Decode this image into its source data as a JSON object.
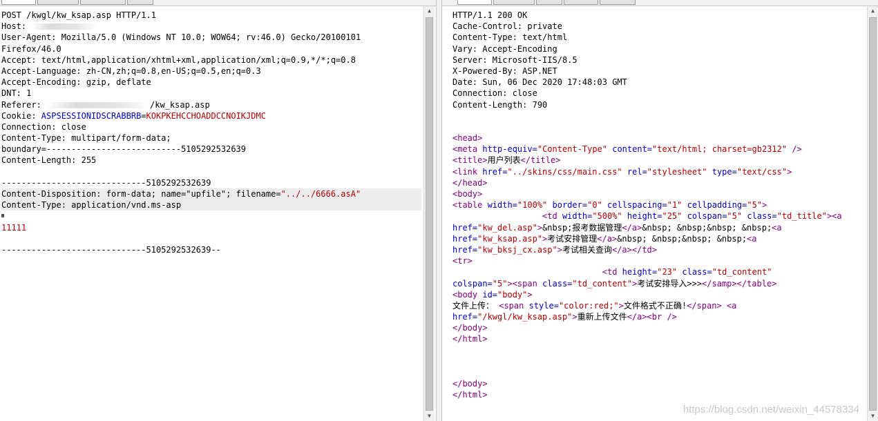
{
  "request": {
    "lines": [
      {
        "t": "POST /kwgl/kw_ksap.asp HTTP/1.1"
      },
      {
        "t": "Host: ",
        "blur": true
      },
      {
        "t": "User-Agent: Mozilla/5.0 (Windows NT 10.0; WOW64; rv:46.0) Gecko/20100101"
      },
      {
        "t": "Firefox/46.0"
      },
      {
        "t": "Accept: text/html,application/xhtml+xml,application/xml;q=0.9,*/*;q=0.8"
      },
      {
        "t": "Accept-Language: zh-CN,zh;q=0.8,en-US;q=0.5,en;q=0.3"
      },
      {
        "t": "Accept-Encoding: gzip, deflate"
      },
      {
        "t": "DNT: 1"
      },
      {
        "t": "Referer: ",
        "blur2": true,
        "t2": "/kw_ksap.asp"
      },
      {
        "cookie": true
      },
      {
        "t": "Connection: close"
      },
      {
        "t": "Content-Type: multipart/form-data;"
      },
      {
        "t": "boundary=---------------------------5105292532639"
      },
      {
        "t": "Content-Length: 255"
      },
      {
        "t": ""
      },
      {
        "t": "-----------------------------5105292532639"
      },
      {
        "disp": true,
        "hl": true
      },
      {
        "t": "Content-Type: application/vnd.ms-asp",
        "hl": true
      },
      {
        "t": "",
        "cursor": true
      },
      {
        "t": "11111",
        "red": true
      },
      {
        "t": ""
      },
      {
        "t": "-----------------------------5105292532639--"
      }
    ],
    "cookie_label": "Cookie: ",
    "cookie_name": "ASPSESSIONIDSCRABBRB",
    "cookie_value": "KOKPKEHCCHOADDCCNOIKJDMC",
    "disp_prefix": "Content-Disposition: form-data; name=\"upfile\"; filename=",
    "disp_filename": "\"../../6666.asA\""
  },
  "response": {
    "lines": [
      [
        {
          "c": "p",
          "t": "HTTP/1.1 200 OK"
        }
      ],
      [
        {
          "c": "p",
          "t": "Cache-Control: private"
        }
      ],
      [
        {
          "c": "p",
          "t": "Content-Type: text/html"
        }
      ],
      [
        {
          "c": "p",
          "t": "Vary: Accept-Encoding"
        }
      ],
      [
        {
          "c": "p",
          "t": "Server: Microsoft-IIS/8.5"
        }
      ],
      [
        {
          "c": "p",
          "t": "X-Powered-By: ASP.NET"
        }
      ],
      [
        {
          "c": "p",
          "t": "Date: Sun, 06 Dec 2020 17:48:03 GMT"
        }
      ],
      [
        {
          "c": "p",
          "t": "Connection: close"
        }
      ],
      [
        {
          "c": "p",
          "t": "Content-Length: 790"
        }
      ],
      [],
      [],
      [
        {
          "c": "tag",
          "t": "<head>"
        }
      ],
      [
        {
          "c": "tag",
          "t": "<meta "
        },
        {
          "c": "attr",
          "t": "http-equiv="
        },
        {
          "c": "val",
          "t": "\"Content-Type\""
        },
        {
          "c": "p",
          "t": " "
        },
        {
          "c": "attr",
          "t": "content="
        },
        {
          "c": "val",
          "t": "\"text/html; charset=gb2312\""
        },
        {
          "c": "tag",
          "t": " />"
        }
      ],
      [
        {
          "c": "tag",
          "t": "<title>"
        },
        {
          "c": "p",
          "t": "用户列表"
        },
        {
          "c": "tag",
          "t": "</title>"
        }
      ],
      [
        {
          "c": "tag",
          "t": "<link "
        },
        {
          "c": "attr",
          "t": "href="
        },
        {
          "c": "val",
          "t": "\"../skins/css/main.css\""
        },
        {
          "c": "p",
          "t": " "
        },
        {
          "c": "attr",
          "t": "rel="
        },
        {
          "c": "val",
          "t": "\"stylesheet\""
        },
        {
          "c": "p",
          "t": " "
        },
        {
          "c": "attr",
          "t": "type="
        },
        {
          "c": "val",
          "t": "\"text/css\""
        },
        {
          "c": "tag",
          "t": ">"
        }
      ],
      [
        {
          "c": "tag",
          "t": "</head>"
        }
      ],
      [
        {
          "c": "tag",
          "t": "<body>"
        }
      ],
      [
        {
          "c": "tag",
          "t": "<table "
        },
        {
          "c": "attr",
          "t": "width="
        },
        {
          "c": "val",
          "t": "\"100%\""
        },
        {
          "c": "p",
          "t": " "
        },
        {
          "c": "attr",
          "t": "border="
        },
        {
          "c": "val",
          "t": "\"0\""
        },
        {
          "c": "p",
          "t": " "
        },
        {
          "c": "attr",
          "t": "cellspacing="
        },
        {
          "c": "val",
          "t": "\"1\""
        },
        {
          "c": "p",
          "t": " "
        },
        {
          "c": "attr",
          "t": "cellpadding="
        },
        {
          "c": "val",
          "t": "\"5\""
        },
        {
          "c": "tag",
          "t": ">"
        }
      ],
      [
        {
          "c": "p",
          "t": "                  "
        },
        {
          "c": "tag",
          "t": "<td "
        },
        {
          "c": "attr",
          "t": "width="
        },
        {
          "c": "val",
          "t": "\"500%\""
        },
        {
          "c": "p",
          "t": " "
        },
        {
          "c": "attr",
          "t": "height="
        },
        {
          "c": "val",
          "t": "\"25\""
        },
        {
          "c": "p",
          "t": " "
        },
        {
          "c": "attr",
          "t": "colspan="
        },
        {
          "c": "val",
          "t": "\"5\""
        },
        {
          "c": "p",
          "t": " "
        },
        {
          "c": "attr",
          "t": "class="
        },
        {
          "c": "val",
          "t": "\"td_title\""
        },
        {
          "c": "tag",
          "t": "><a"
        }
      ],
      [
        {
          "c": "attr",
          "t": "href="
        },
        {
          "c": "val",
          "t": "\"kw_del.asp\""
        },
        {
          "c": "tag",
          "t": ">"
        },
        {
          "c": "p",
          "t": "&nbsp;报考数据管理"
        },
        {
          "c": "tag",
          "t": "</a>"
        },
        {
          "c": "p",
          "t": "&nbsp; &nbsp;&nbsp; &nbsp;"
        },
        {
          "c": "tag",
          "t": "<a"
        }
      ],
      [
        {
          "c": "attr",
          "t": "href="
        },
        {
          "c": "val",
          "t": "\"kw_ksap.asp\""
        },
        {
          "c": "tag",
          "t": ">"
        },
        {
          "c": "p",
          "t": "考试安排管理"
        },
        {
          "c": "tag",
          "t": "</a>"
        },
        {
          "c": "p",
          "t": "&nbsp; &nbsp;&nbsp; &nbsp;"
        },
        {
          "c": "tag",
          "t": "<a"
        }
      ],
      [
        {
          "c": "attr",
          "t": "href="
        },
        {
          "c": "val",
          "t": "\"kw_bksj_cx.asp\""
        },
        {
          "c": "tag",
          "t": ">"
        },
        {
          "c": "p",
          "t": "考试相关查询"
        },
        {
          "c": "tag",
          "t": "</a></td>"
        }
      ],
      [
        {
          "c": "tag",
          "t": "<tr>"
        }
      ],
      [
        {
          "c": "p",
          "t": "                              "
        },
        {
          "c": "tag",
          "t": "<td "
        },
        {
          "c": "attr",
          "t": "height="
        },
        {
          "c": "val",
          "t": "\"23\""
        },
        {
          "c": "p",
          "t": " "
        },
        {
          "c": "attr",
          "t": "class="
        },
        {
          "c": "val",
          "t": "\"td_content\""
        }
      ],
      [
        {
          "c": "attr",
          "t": "colspan="
        },
        {
          "c": "val",
          "t": "\"5\""
        },
        {
          "c": "tag",
          "t": "><span "
        },
        {
          "c": "attr",
          "t": "class="
        },
        {
          "c": "val",
          "t": "\"td_content\""
        },
        {
          "c": "tag",
          "t": ">"
        },
        {
          "c": "p",
          "t": "考试安排导入>>>"
        },
        {
          "c": "tag",
          "t": "</samp></table>"
        }
      ],
      [
        {
          "c": "tag",
          "t": "<body "
        },
        {
          "c": "attr",
          "t": "id="
        },
        {
          "c": "val",
          "t": "\"body\""
        },
        {
          "c": "tag",
          "t": ">"
        }
      ],
      [
        {
          "c": "p",
          "t": "文件上传： "
        },
        {
          "c": "tag",
          "t": "<span "
        },
        {
          "c": "attr",
          "t": "style="
        },
        {
          "c": "val",
          "t": "\"color:red;\""
        },
        {
          "c": "tag",
          "t": ">"
        },
        {
          "c": "p",
          "t": "文件格式不正确!"
        },
        {
          "c": "tag",
          "t": "</span>"
        },
        {
          "c": "p",
          "t": " "
        },
        {
          "c": "tag",
          "t": "<a"
        }
      ],
      [
        {
          "c": "attr",
          "t": "href="
        },
        {
          "c": "val",
          "t": "\"/kwgl/kw_ksap.asp\""
        },
        {
          "c": "tag",
          "t": ">"
        },
        {
          "c": "p",
          "t": "重新上传文件"
        },
        {
          "c": "tag",
          "t": "</a><br />"
        }
      ],
      [
        {
          "c": "tag",
          "t": "</body>"
        }
      ],
      [
        {
          "c": "tag",
          "t": "</html>"
        }
      ],
      [],
      [],
      [],
      [
        {
          "c": "tag",
          "t": "</body>"
        }
      ],
      [
        {
          "c": "tag",
          "t": "</html>"
        }
      ]
    ]
  },
  "watermark": "https://blog.csdn.net/weixin_44578334"
}
